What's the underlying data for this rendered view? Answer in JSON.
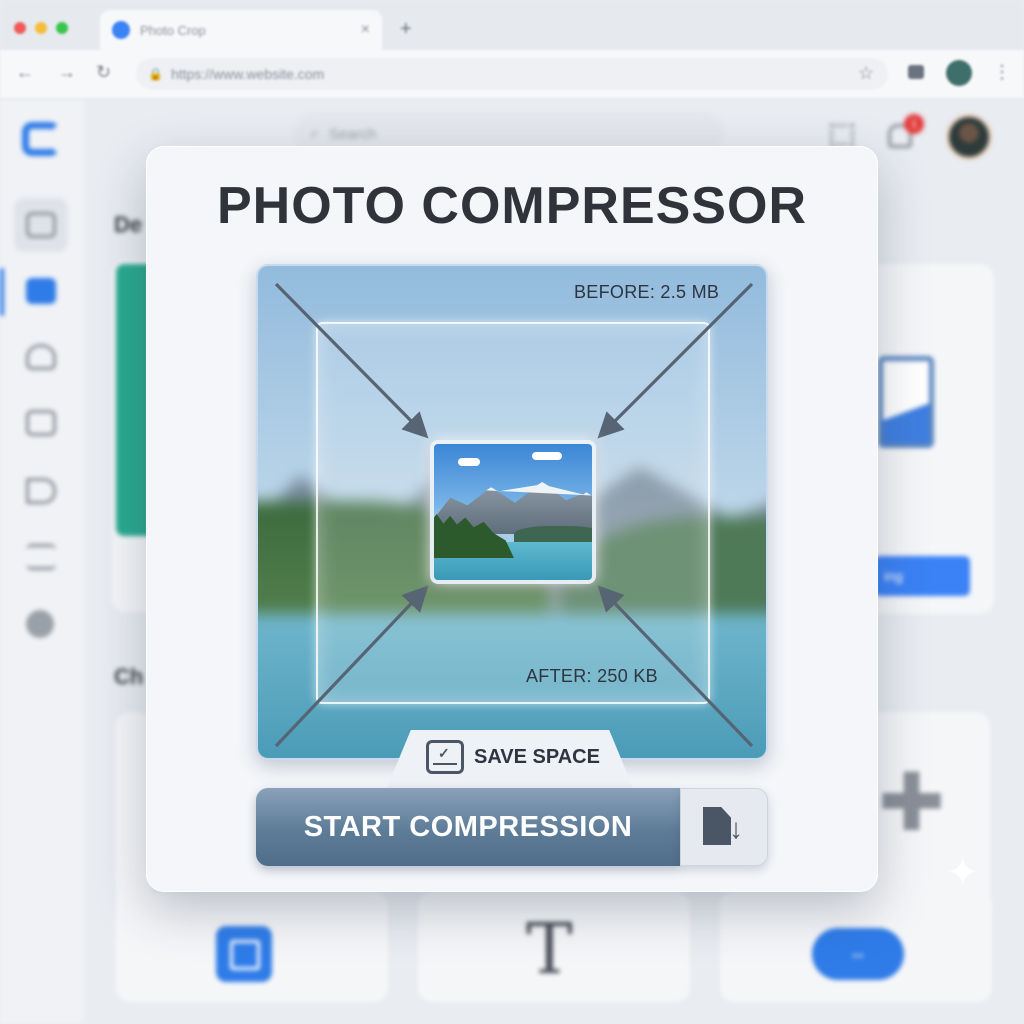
{
  "browser": {
    "tab_title": "Photo Crop",
    "url": "https://www.website.com",
    "traffic_lights": [
      "#f05b57",
      "#f6bd3b",
      "#39c649"
    ]
  },
  "background_app": {
    "search_placeholder": "Search",
    "notification_count": "1",
    "section_1_heading": "De",
    "section_2_heading": "Ch",
    "blue_button_label": "ing",
    "text_tool_glyph": "T",
    "accent_color": "#2f7ce8"
  },
  "modal": {
    "title": "PHOTO COMPRESSOR",
    "before_label": "BEFORE: 2.5 MB",
    "after_label": "AFTER: 250 KB",
    "save_label": "SAVE SPACE",
    "start_button": "START COMPRESSION",
    "button_color": "#5d7c98"
  }
}
